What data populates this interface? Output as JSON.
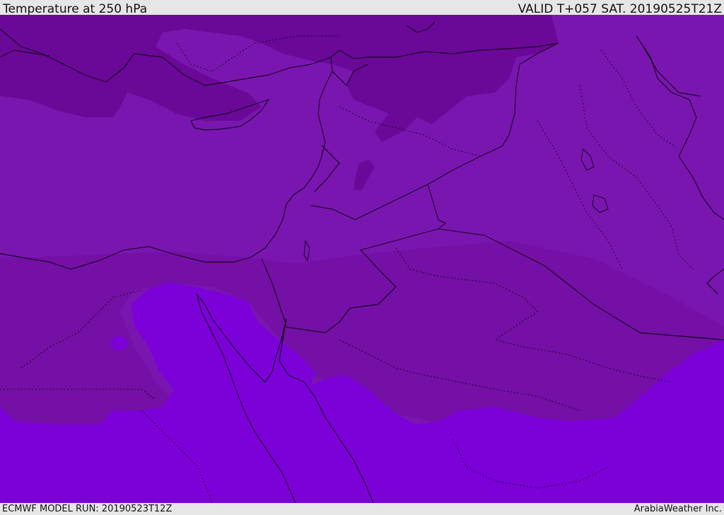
{
  "header": {
    "title": "Temperature at 250 hPa",
    "valid": "VALID T+057 SAT. 20190525T21Z"
  },
  "footer": {
    "model_run": "ECMWF MODEL RUN: 20190523T12Z",
    "credit": "ArabiaWeather Inc."
  },
  "map": {
    "colors": {
      "coldest_band": "#6a0898",
      "mid_band": "#7a16b0",
      "cool_band": "#7410a6",
      "warm_band": "#7c00d8",
      "border": "#000000"
    }
  }
}
